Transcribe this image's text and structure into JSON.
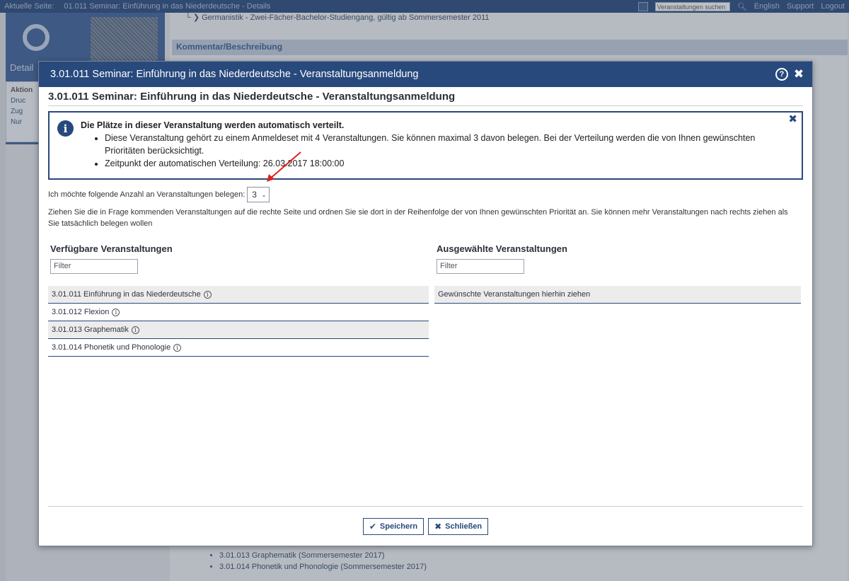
{
  "topbar": {
    "current_label": "Aktuelle Seite:",
    "current_page": "01.011 Seminar: Einführung in das Niederdeutsche - Details",
    "search_placeholder": "Veranstaltungen suchen",
    "links": [
      "English",
      "Support",
      "Logout"
    ]
  },
  "background": {
    "course_line": "Germanistik - Zwei-Fächer-Bachelor-Studiengang, gültig ab Sommersemester 2011",
    "section_title": "Kommentar/Beschreibung",
    "side_title": "Detail",
    "actions_title": "Aktion",
    "actions": [
      "Druc",
      "Zug",
      "Nur"
    ],
    "list_items": [
      "3.01.013 Graphematik (Sommersemester 2017)",
      "3.01.014 Phonetik und Phonologie (Sommersemester 2017)"
    ]
  },
  "dialog": {
    "header_title": "3.01.011 Seminar: Einführung in das Niederdeutsche - Veranstaltungsanmeldung",
    "page_title": "3.01.011 Seminar: Einführung in das Niederdeutsche - Veranstaltungsanmeldung",
    "info": {
      "title": "Die Plätze in dieser Veranstaltung werden automatisch verteilt.",
      "bullets": [
        "Diese Veranstaltung gehört zu einem Anmeldeset mit 4 Veranstaltungen. Sie können maximal 3 davon belegen. Bei der Verteilung werden die von Ihnen gewünschten Prioritäten berücksichtigt.",
        "Zeitpunkt der automatischen Verteilung: 26.03.2017 18:00:00"
      ]
    },
    "count_label": "Ich möchte folgende Anzahl an Veranstaltungen belegen:",
    "count_value": "3",
    "instructions": "Ziehen Sie die in Frage kommenden Veranstaltungen auf die rechte Seite und ordnen Sie sie dort in der Reihenfolge der von Ihnen gewünschten Priorität an. Sie können mehr Veranstaltungen nach rechts ziehen als Sie tatsächlich belegen wollen",
    "available": {
      "title": "Verfügbare Veranstaltungen",
      "filter_placeholder": "Filter",
      "items": [
        "3.01.011 Einführung in das Niederdeutsche",
        "3.01.012 Flexion",
        "3.01.013 Graphematik",
        "3.01.014 Phonetik und Phonologie"
      ]
    },
    "selected": {
      "title": "Ausgewählte Veranstaltungen",
      "filter_placeholder": "Filter",
      "drop_hint": "Gewünschte Veranstaltungen hierhin ziehen"
    },
    "buttons": {
      "save": "Speichern",
      "close": "Schließen"
    }
  },
  "colors": {
    "header": "#28497c",
    "annotation_arrow": "#e0201a"
  }
}
